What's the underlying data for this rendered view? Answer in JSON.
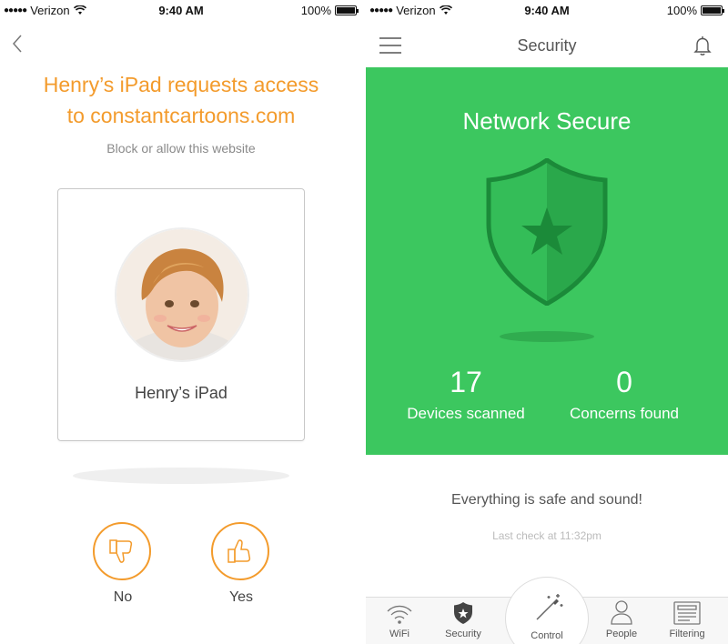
{
  "status_left": {
    "carrier": "Verizon",
    "time": "9:40 AM",
    "battery": "100%"
  },
  "status_right": {
    "carrier": "Verizon",
    "time": "9:40 AM",
    "battery": "100%"
  },
  "access_request": {
    "title_line1": "Henry’s iPad requests access",
    "title_line2": "to constantcartoons.com",
    "subtitle": "Block or allow this website",
    "device_name": "Henry’s iPad",
    "no_label": "No",
    "yes_label": "Yes",
    "accent_color": "#f39b2c"
  },
  "security": {
    "nav_title": "Security",
    "panel_title": "Network Secure",
    "panel_color": "#3cc75f",
    "stats": [
      {
        "value": "17",
        "caption": "Devices scanned"
      },
      {
        "value": "0",
        "caption": "Concerns found"
      }
    ],
    "message": "Everything is safe and sound!",
    "last_check": "Last check at 11:32pm"
  },
  "tabbar": {
    "items": [
      {
        "label": "WiFi",
        "icon": "wifi-icon"
      },
      {
        "label": "Security",
        "icon": "shield-icon"
      },
      {
        "label": "Control",
        "icon": "magic-wand-icon"
      },
      {
        "label": "People",
        "icon": "person-icon"
      },
      {
        "label": "Filtering",
        "icon": "filter-icon"
      }
    ]
  }
}
